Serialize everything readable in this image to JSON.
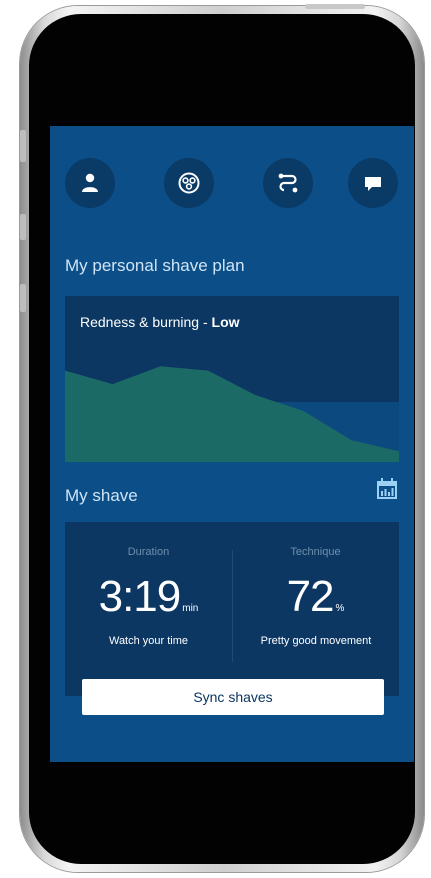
{
  "nav": {
    "items": [
      {
        "icon": "user-icon"
      },
      {
        "icon": "shaver-heads-icon"
      },
      {
        "icon": "routine-icon"
      },
      {
        "icon": "chat-icon"
      }
    ]
  },
  "plan": {
    "title": "My personal shave plan",
    "metric_label": "Redness & burning - ",
    "metric_level": "Low",
    "area_color": "#1c6a66",
    "chart_data": {
      "type": "area",
      "values": [
        7.8,
        6.6,
        8.2,
        7.8,
        5.6,
        4.2,
        1.6,
        0.6
      ]
    }
  },
  "shave": {
    "title": "My shave",
    "duration": {
      "label": "Duration",
      "value": "3:19",
      "unit": "min",
      "note": "Watch your time"
    },
    "technique": {
      "label": "Technique",
      "value": "72",
      "unit": "%",
      "note": "Pretty good movement"
    },
    "sync_label": "Sync shaves"
  },
  "colors": {
    "screen_bg": "#0b4e88",
    "card_bg": "#0b3762",
    "accent_light": "#cfe4f6"
  }
}
